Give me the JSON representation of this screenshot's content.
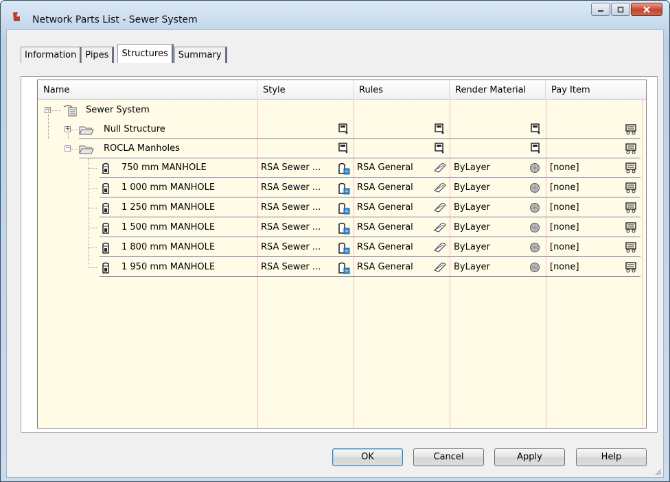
{
  "window": {
    "title": "Network Parts List - Sewer System"
  },
  "tabs": [
    {
      "label": "Information"
    },
    {
      "label": "Pipes"
    },
    {
      "label": "Structures",
      "active": true
    },
    {
      "label": "Summary"
    }
  ],
  "columns": [
    "Name",
    "Style",
    "Rules",
    "Render Material",
    "Pay Item"
  ],
  "tree": {
    "root": "Sewer System",
    "groups": [
      {
        "label": "Null Structure",
        "expanded": false
      },
      {
        "label": "ROCLA Manholes",
        "expanded": true
      }
    ],
    "items": [
      {
        "name": "750 mm MANHOLE",
        "style": "RSA Sewer ...",
        "rules": "RSA General",
        "material": "ByLayer",
        "pay_item": "[none]"
      },
      {
        "name": "1 000 mm MANHOLE",
        "style": "RSA Sewer ...",
        "rules": "RSA General",
        "material": "ByLayer",
        "pay_item": "[none]"
      },
      {
        "name": "1 250 mm MANHOLE",
        "style": "RSA Sewer ...",
        "rules": "RSA General",
        "material": "ByLayer",
        "pay_item": "[none]"
      },
      {
        "name": "1 500 mm MANHOLE",
        "style": "RSA Sewer ...",
        "rules": "RSA General",
        "material": "ByLayer",
        "pay_item": "[none]"
      },
      {
        "name": "1 800 mm MANHOLE",
        "style": "RSA Sewer ...",
        "rules": "RSA General",
        "material": "ByLayer",
        "pay_item": "[none]"
      },
      {
        "name": "1 950 mm MANHOLE",
        "style": "RSA Sewer ...",
        "rules": "RSA General",
        "material": "ByLayer",
        "pay_item": "[none]"
      }
    ]
  },
  "buttons": {
    "ok": "OK",
    "cancel": "Cancel",
    "apply": "Apply",
    "help": "Help"
  },
  "colors": {
    "grid_bg": "#fffbe6",
    "column_line": "#f4b9c0",
    "row_line": "#6a7ea8"
  }
}
